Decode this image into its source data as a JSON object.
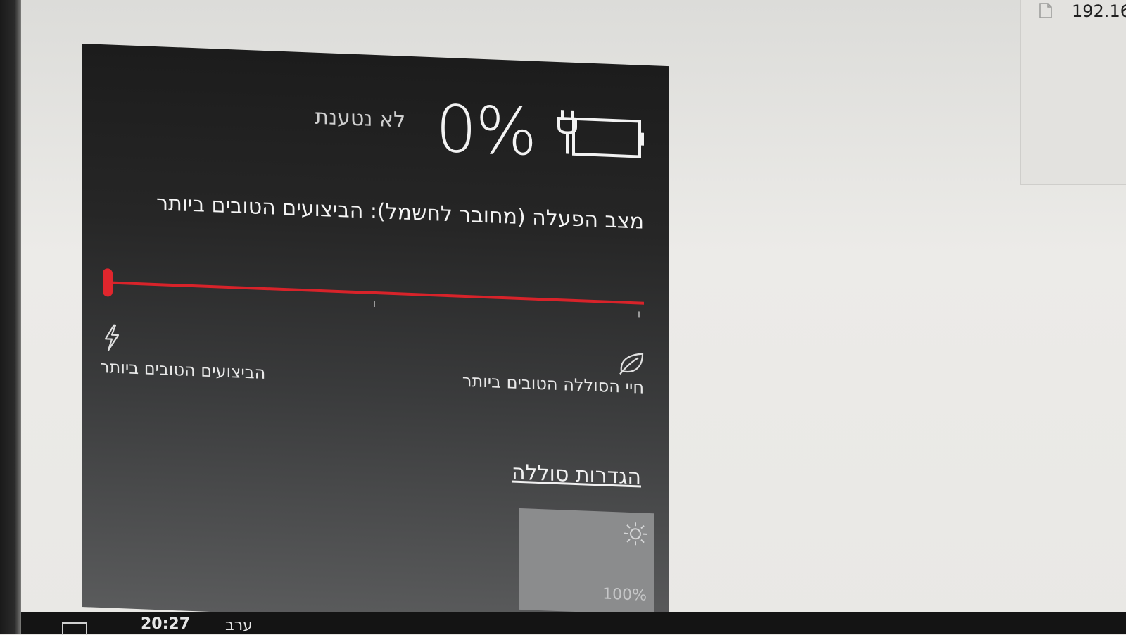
{
  "desktop": {
    "ip_address": "192.16"
  },
  "battery_flyout": {
    "percent": "0%",
    "charge_status": "לא נטענת",
    "power_mode_label": "מצב הפעלה (מחובר לחשמל): הביצועים הטובים ביותר",
    "slider": {
      "left_label": "הביצועים הטובים ביותר",
      "right_label": "חיי הסוללה הטובים ביותר",
      "value_fraction": 1.0
    },
    "battery_settings_link": "הגדרות סוללה",
    "brightness_tile": {
      "value": "100%",
      "icon": "sun-icon"
    },
    "icons": {
      "battery": "battery-plugged-icon",
      "performance": "lightning-icon",
      "battery_saver": "leaf-icon"
    },
    "accent_color": "#d8232a"
  },
  "taskbar": {
    "time": "20:27",
    "period": "ערב"
  }
}
